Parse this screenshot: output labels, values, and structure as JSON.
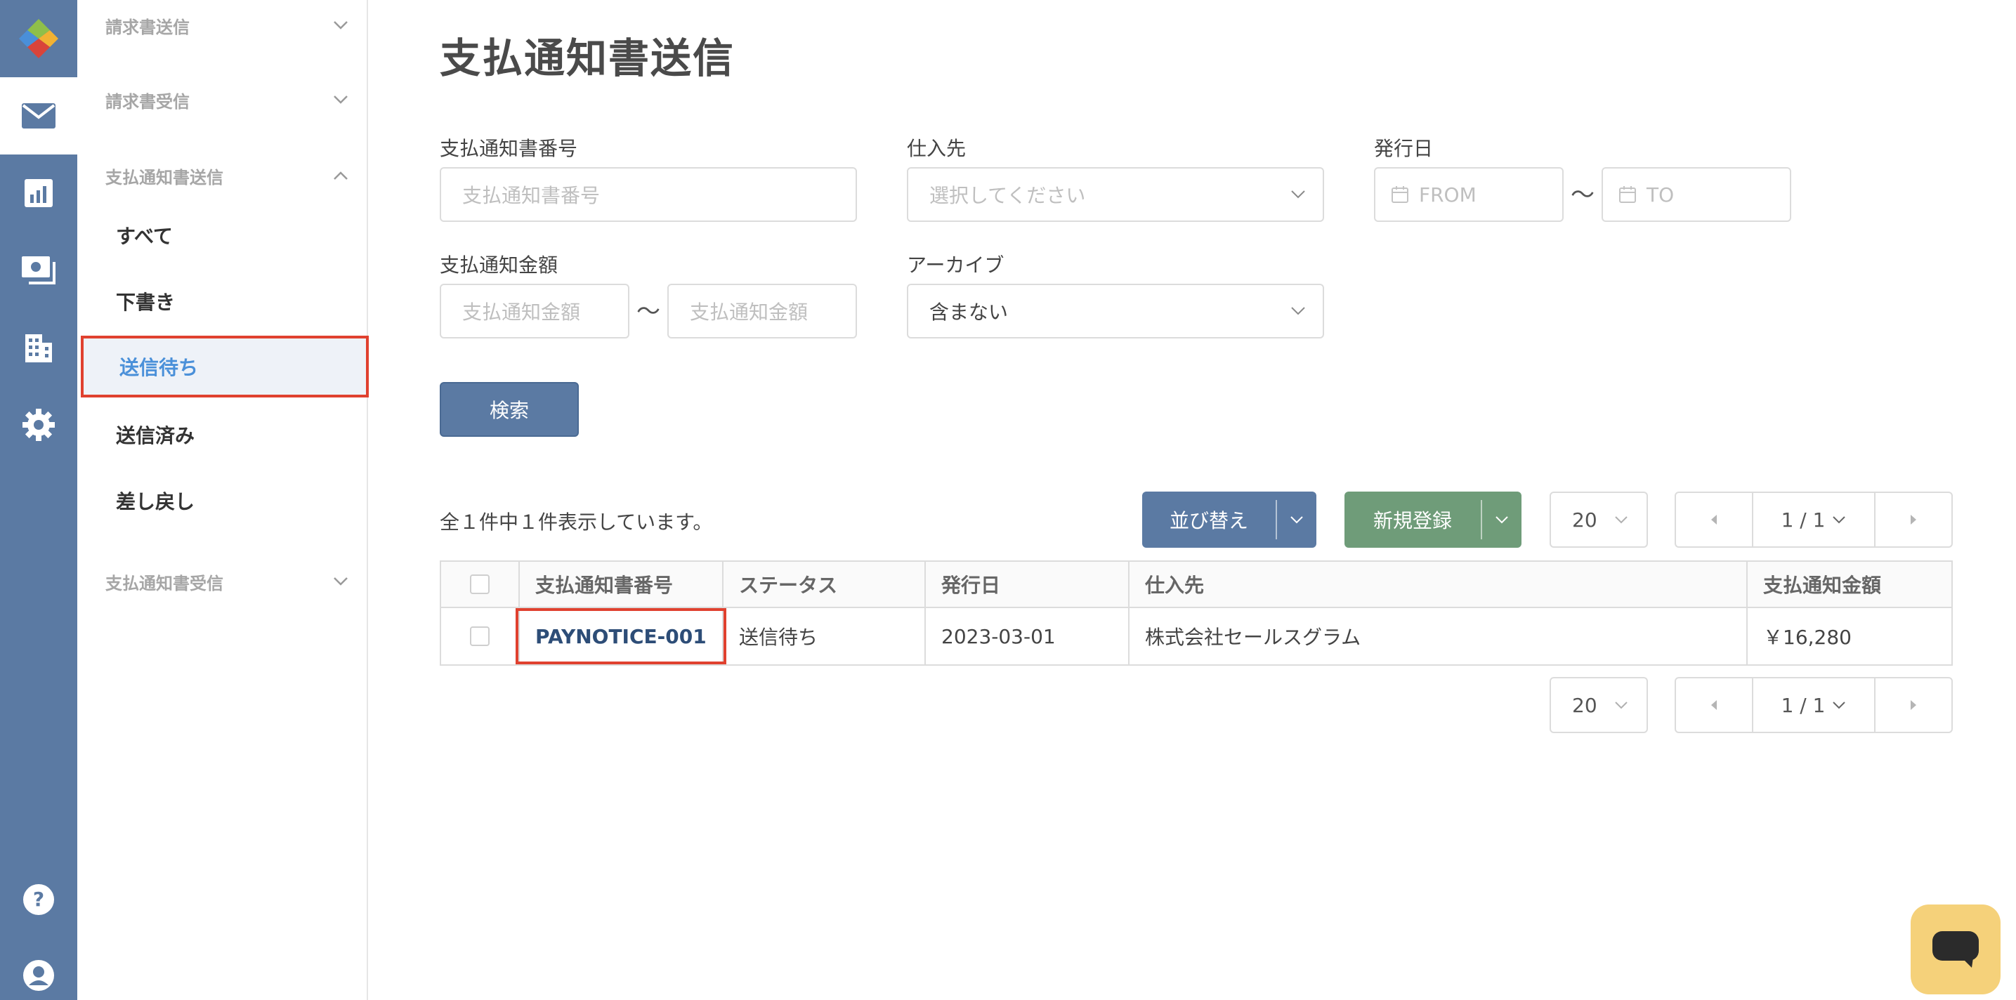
{
  "rail": {
    "items": [
      {
        "id": "mail",
        "icon": "mail-icon",
        "active": true
      },
      {
        "id": "chart",
        "icon": "chart-icon",
        "active": false
      },
      {
        "id": "money",
        "icon": "banknote-icon",
        "active": false
      },
      {
        "id": "building",
        "icon": "building-icon",
        "active": false
      },
      {
        "id": "settings",
        "icon": "gear-icon",
        "active": false
      }
    ],
    "bottom": [
      {
        "id": "help",
        "icon": "help-icon"
      },
      {
        "id": "account",
        "icon": "user-icon"
      }
    ]
  },
  "sidebar": {
    "sections": {
      "invoice_send": "請求書送信",
      "invoice_receive": "請求書受信",
      "notice_send": "支払通知書送信",
      "notice_receive": "支払通知書受信"
    },
    "items": {
      "all": "すべて",
      "draft": "下書き",
      "waiting": "送信待ち",
      "sent": "送信済み",
      "returned": "差し戻し"
    }
  },
  "page": {
    "title": "支払通知書送信"
  },
  "filters": {
    "number_label": "支払通知書番号",
    "number_placeholder": "支払通知書番号",
    "supplier_label": "仕入先",
    "supplier_placeholder": "選択してください",
    "issue_date_label": "発行日",
    "from_placeholder": "FROM",
    "to_placeholder": "TO",
    "range_sep": "〜",
    "amount_label": "支払通知金額",
    "amount_min_placeholder": "支払通知金額",
    "amount_max_placeholder": "支払通知金額",
    "archive_label": "アーカイブ",
    "archive_value": "含まない",
    "search_button": "検索"
  },
  "list": {
    "count_text": "全１件中１件表示しています。",
    "sort_button": "並び替え",
    "new_button": "新規登録",
    "per_page": "20",
    "page_indicator": "1 / 1",
    "columns": [
      "支払通知書番号",
      "ステータス",
      "発行日",
      "仕入先",
      "支払通知金額"
    ],
    "rows": [
      {
        "number": "PAYNOTICE-001",
        "status": "送信待ち",
        "issue_date": "2023-03-01",
        "supplier": "株式会社セールスグラム",
        "amount": "￥16,280"
      }
    ]
  },
  "colors": {
    "rail": "#5b7aa3",
    "primary_button": "#5b7aa3",
    "new_button": "#6f9c79",
    "highlight": "#e0412f",
    "active_text": "#4a90d9",
    "chat": "#f5d17a"
  }
}
